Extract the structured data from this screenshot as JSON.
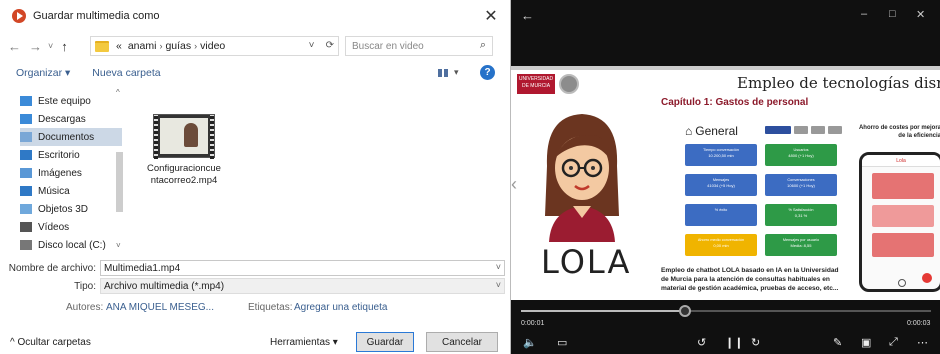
{
  "dialog": {
    "title": "Guardar multimedia como",
    "close": "✕",
    "nav": {
      "back": "←",
      "forward": "→",
      "recent": "˅",
      "up": "↑"
    },
    "address": {
      "prefix": "«",
      "segments": [
        "anami",
        "guías",
        "video"
      ],
      "sep": "›",
      "dropdown": "˅",
      "refresh": "⟳"
    },
    "search_placeholder": "Buscar en video",
    "toolbar": {
      "organize": "Organizar ▾",
      "new_folder": "Nueva carpeta",
      "view_caret": "▾",
      "help": "?"
    },
    "nav_pane": {
      "items": [
        {
          "label": "Este equipo",
          "icon": "computer-icon",
          "color": "#3b8ad8"
        },
        {
          "label": "Descargas",
          "icon": "download-icon",
          "color": "#3b8ad8"
        },
        {
          "label": "Documentos",
          "icon": "documents-icon",
          "color": "#7aa7d6"
        },
        {
          "label": "Escritorio",
          "icon": "desktop-icon",
          "color": "#2f79c6"
        },
        {
          "label": "Imágenes",
          "icon": "pictures-icon",
          "color": "#5a98d6"
        },
        {
          "label": "Música",
          "icon": "music-icon",
          "color": "#2f79c6"
        },
        {
          "label": "Objetos 3D",
          "icon": "objects3d-icon",
          "color": "#6fa8dc"
        },
        {
          "label": "Vídeos",
          "icon": "videos-icon",
          "color": "#555555"
        },
        {
          "label": "Disco local (C:)",
          "icon": "disk-icon",
          "color": "#777777"
        }
      ],
      "selected_index": 2,
      "scroll_up": "▲",
      "scroll_down": "▼",
      "expand": "^",
      "collapse": "˅"
    },
    "file": {
      "name": "Configuracioncuentacorreo2.mp4"
    },
    "form": {
      "filename_label": "Nombre de archivo:",
      "filename_value": "Multimedia1.mp4",
      "type_label": "Tipo:",
      "type_value": "Archivo multimedia (*.mp4)",
      "authors_label": "Autores:",
      "authors_value": "ANA MIQUEL MESEG...",
      "tags_label": "Etiquetas:",
      "tags_value": "Agregar una etiqueta",
      "caret": "˅"
    },
    "footer": {
      "hide_folders": "^ Ocultar carpetas",
      "tools": "Herramientas ▾",
      "save": "Guardar",
      "cancel": "Cancelar"
    }
  },
  "player": {
    "back": "←",
    "window": {
      "minimize": "–",
      "maximize": "□",
      "close": "✕"
    },
    "slide": {
      "university": "UNIVERSIDAD DE MURCIA",
      "title": "Empleo de tecnologías disruptiva",
      "chapter": "Capítulo 1: Gastos de personal",
      "lola": "LOLA",
      "dash_title": "General",
      "tiles": [
        {
          "label": "Tiempo conversación",
          "value": "10.200,50 min",
          "color": "#3c6cc2"
        },
        {
          "label": "Usuarios",
          "value": "4800 (+1 Hoy)",
          "color": "#2e9a47"
        },
        {
          "label": "Mensajes",
          "value": "41034 (+5 Hoy)",
          "color": "#3c6cc2"
        },
        {
          "label": "Conversaciones",
          "value": "10600 (+1 Hoy)",
          "color": "#3c6cc2"
        },
        {
          "label": "% éxito",
          "value": "",
          "color": "#3c6cc2"
        },
        {
          "label": "% Satisfacción",
          "value": "0,31 %",
          "color": "#2e9a47"
        },
        {
          "label": "Ahorro medio conversación",
          "value": "0,00 min",
          "color": "#f0b400"
        },
        {
          "label": "Mensajes por usuario",
          "value": "Media: 8,55",
          "color": "#2e9a47"
        }
      ],
      "chat_caption_line1": "Ahorro de costes por mejora",
      "chat_caption_line2": "de la eficiencia",
      "phone_header": "Lola",
      "caption": "Empleo de chatbot LOLA basado en IA en la Universidad de Murcia para la atención de consultas habituales en material de gestión académica, pruebas de acceso, etc..."
    },
    "time_current": "0:00:01",
    "time_total": "0:00:03",
    "progress": 0.4,
    "controls": {
      "volume": "🔈",
      "captions": "▭",
      "rewind": "↺",
      "pause": "❙❙",
      "forward": "↻",
      "edit": "✎",
      "miniplayer": "▣",
      "fullscreen": "⤢",
      "more": "⋯"
    }
  }
}
